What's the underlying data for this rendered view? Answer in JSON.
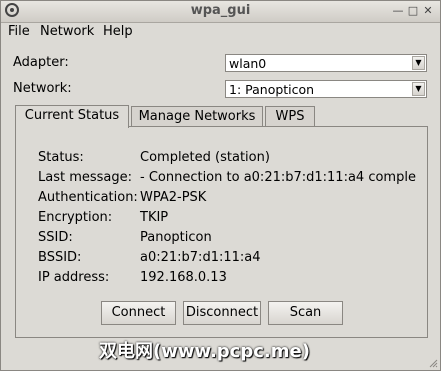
{
  "window": {
    "title": "wpa_gui"
  },
  "menu": {
    "file": "File",
    "network": "Network",
    "help": "Help"
  },
  "adapter": {
    "label": "Adapter:",
    "value": "wlan0"
  },
  "network": {
    "label": "Network:",
    "value": "1: Panopticon"
  },
  "tabs": [
    {
      "label": "Current Status"
    },
    {
      "label": "Manage Networks"
    },
    {
      "label": "WPS"
    }
  ],
  "status": {
    "rows": [
      {
        "label": "Status:",
        "value": "Completed (station)"
      },
      {
        "label": "Last message:",
        "value": "- Connection to a0:21:b7:d1:11:a4 comple"
      },
      {
        "label": "Authentication:",
        "value": "WPA2-PSK"
      },
      {
        "label": "Encryption:",
        "value": "TKIP"
      },
      {
        "label": "SSID:",
        "value": "Panopticon"
      },
      {
        "label": "BSSID:",
        "value": "a0:21:b7:d1:11:a4"
      },
      {
        "label": "IP address:",
        "value": "192.168.0.13"
      }
    ]
  },
  "buttons": {
    "connect": "Connect",
    "disconnect": "Disconnect",
    "scan": "Scan"
  },
  "watermark": "双电网(www.pcpc.me)"
}
